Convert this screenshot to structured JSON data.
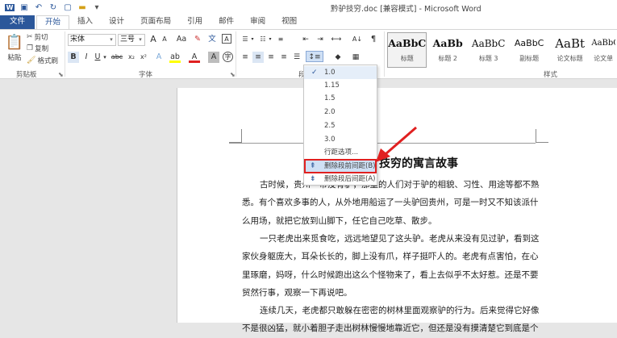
{
  "window": {
    "title": "黔驴技穷.doc [兼容模式] - Microsoft Word"
  },
  "tabs": [
    "文件",
    "开始",
    "插入",
    "设计",
    "页面布局",
    "引用",
    "邮件",
    "审阅",
    "视图"
  ],
  "clipboard": {
    "paste": "粘贴",
    "cut": "剪切",
    "copy": "复制",
    "painter": "格式刷",
    "group": "剪贴板"
  },
  "font": {
    "name": "宋体",
    "size": "三号",
    "group": "字体",
    "grow": "A",
    "shrink": "A",
    "clear": "A",
    "bold": "B",
    "italic": "I",
    "underline": "U",
    "strike": "abc",
    "sub": "x₂",
    "sup": "x²"
  },
  "paragraph": {
    "group": "段"
  },
  "styles": {
    "group": "样式",
    "items": [
      {
        "preview": "AaBbC",
        "name": "标题"
      },
      {
        "preview": "AaBb",
        "name": "标题 2"
      },
      {
        "preview": "AaBbC",
        "name": "标题 3"
      },
      {
        "preview": "AaBbC",
        "name": "副标题"
      },
      {
        "preview": "AaBt",
        "name": "论文标题"
      },
      {
        "preview": "AaBbC",
        "name": "论文单"
      }
    ]
  },
  "menu": {
    "items": [
      "1.0",
      "1.15",
      "1.5",
      "2.0",
      "2.5",
      "3.0",
      "行距选项...",
      "删除段前间距(B)",
      "删除段后间距(A)"
    ],
    "checked": "1.0",
    "highlighted": "删除段前间距(B)"
  },
  "document": {
    "title": "技穷的寓言故事",
    "paragraphs": [
      {
        "lines": [
          "古时候，贵州一带没有驴，那里的人们对于驴的相貌、习性、用途等都不熟",
          "悉。有个喜欢多事的人，从外地用船运了一头驴回贵州，可是一时又不知该派什",
          "么用场，就把它放到山脚下，任它自己吃草、散步。"
        ]
      },
      {
        "lines": [
          "一只老虎出来觅食吃，远远地望见了这头驴。老虎从来没有见过驴，看到这",
          "家伙身躯庞大，耳朵长长的，脚上没有爪，样子挺吓人的。老虎有点害怕，在心",
          "里琢磨，妈呀，什么时候跑出这么个怪物来了，看上去似乎不太好惹。还是不要",
          "贸然行事，观察一下再说吧。"
        ]
      },
      {
        "lines": [
          "连续几天，老虎都只敢躲在密密的树林里面观察驴的行为。后来觉得它好像",
          "不是很凶猛，就小着胆子走出树林慢慢地靠近它，但还是没有摸清楚它到底是个"
        ]
      }
    ]
  },
  "colors": {
    "accent": "#2b579a",
    "highlight_box": "#e02020"
  }
}
